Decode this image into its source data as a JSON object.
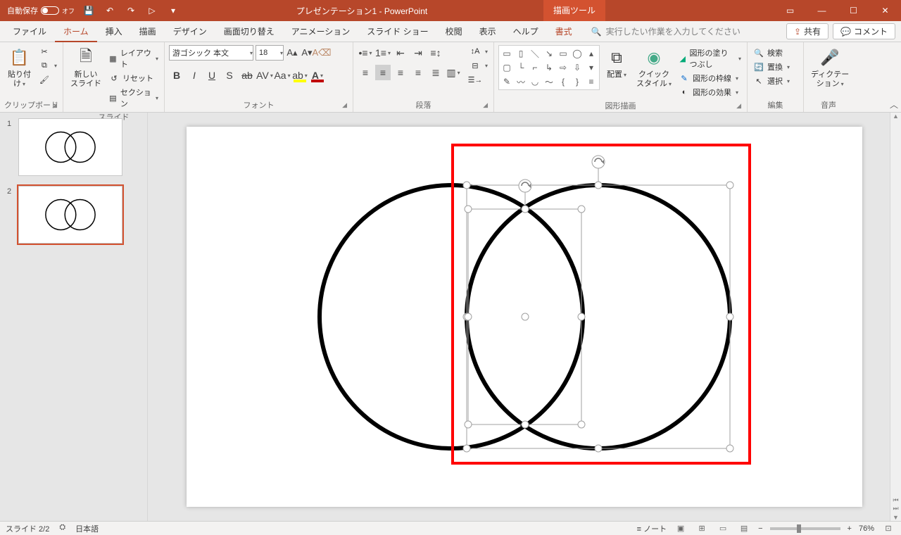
{
  "titlebar": {
    "autosave_label": "自動保存",
    "autosave_state": "オフ",
    "doc_title": "プレゼンテーション1 - PowerPoint",
    "tool_tab": "描画ツール"
  },
  "tabs": {
    "file": "ファイル",
    "home": "ホーム",
    "insert": "挿入",
    "draw": "描画",
    "design": "デザイン",
    "transitions": "画面切り替え",
    "animations": "アニメーション",
    "slideshow": "スライド ショー",
    "review": "校閲",
    "view": "表示",
    "help": "ヘルプ",
    "format": "書式",
    "search_placeholder": "実行したい作業を入力してください",
    "share": "共有",
    "comments": "コメント"
  },
  "ribbon": {
    "clipboard": {
      "label": "クリップボード",
      "paste": "貼り付け"
    },
    "slides": {
      "label": "スライド",
      "new_slide": "新しい\nスライド",
      "layout": "レイアウト",
      "reset": "リセット",
      "section": "セクション"
    },
    "font": {
      "label": "フォント",
      "name": "游ゴシック 本文",
      "size": "18"
    },
    "paragraph": {
      "label": "段落"
    },
    "drawing": {
      "label": "図形描画",
      "arrange": "配置",
      "quick_styles": "クイック\nスタイル",
      "fill": "図形の塗りつぶし",
      "outline": "図形の枠線",
      "effects": "図形の効果"
    },
    "editing": {
      "label": "編集",
      "find": "検索",
      "replace": "置換",
      "select": "選択"
    },
    "voice": {
      "label": "音声",
      "dictate": "ディクテー\nション"
    }
  },
  "slides_panel": {
    "slide1_num": "1",
    "slide2_num": "2"
  },
  "statusbar": {
    "slide_indicator": "スライド 2/2",
    "language": "日本語",
    "notes": "ノート",
    "zoom": "76%"
  }
}
